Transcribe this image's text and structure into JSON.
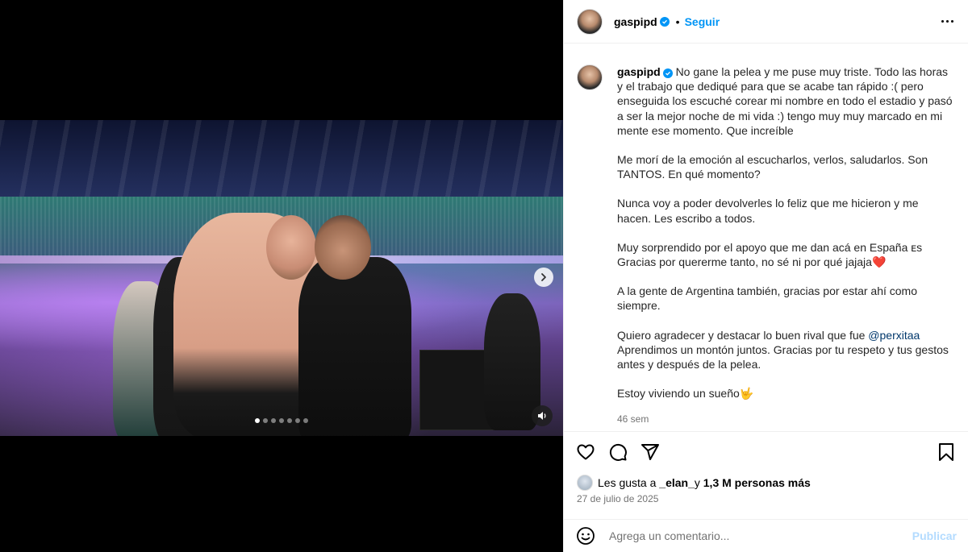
{
  "post": {
    "username": "gaspipd",
    "follow_label": "Seguir",
    "header_separator": "•",
    "caption_paragraphs": [
      "No gane la pelea y me puse muy triste. Todo las horas y el trabajo que dediqué para que se acabe tan rápido :( pero enseguida los escuché corear mi nombre en todo el estadio y pasó a ser la mejor noche de mi vida :) tengo muy muy marcado en mi mente ese momento. Que increíble",
      "Me morí de la emoción al escucharlos, verlos, saludarlos. Son TANTOS. En qué momento?",
      "Nunca voy a poder devolverles lo feliz que me hicieron y me hacen. Les escribo a todos.",
      "Muy sorprendido por el apoyo que me dan acá en España ᴇs Gracias por quererme tanto, no sé ni por qué jajaja❤️",
      "A la gente de Argentina también, gracias por estar ahí como siempre."
    ],
    "caption_mention_paragraph": {
      "before": "Quiero agradecer y destacar lo buen rival que fue ",
      "mention": "@perxitaa",
      "after": " Aprendimos un montón juntos. Gracias por tu respeto y tus gestos antes y después de la pelea."
    },
    "caption_last": "Estoy viviendo un sueño🤟",
    "time_ago": "46 sem",
    "likes": {
      "prefix": "Les gusta a ",
      "user": "_elan_",
      "middle": " y ",
      "count": "1,3 M personas más"
    },
    "date": "27 de julio de 2025",
    "comment_placeholder": "Agrega un comentario...",
    "publish_label": "Publicar"
  },
  "media": {
    "carousel_total": 7,
    "carousel_index": 1
  },
  "icons": {
    "like": "heart-icon",
    "comment": "comment-icon",
    "share": "share-icon",
    "save": "bookmark-icon",
    "emoji": "emoji-icon",
    "next": "chevron-right-icon",
    "mute": "speaker-icon",
    "more": "more-icon"
  },
  "colors": {
    "accent": "#0095f6",
    "publish_disabled": "#b3dbff",
    "secondary_text": "#737373"
  }
}
